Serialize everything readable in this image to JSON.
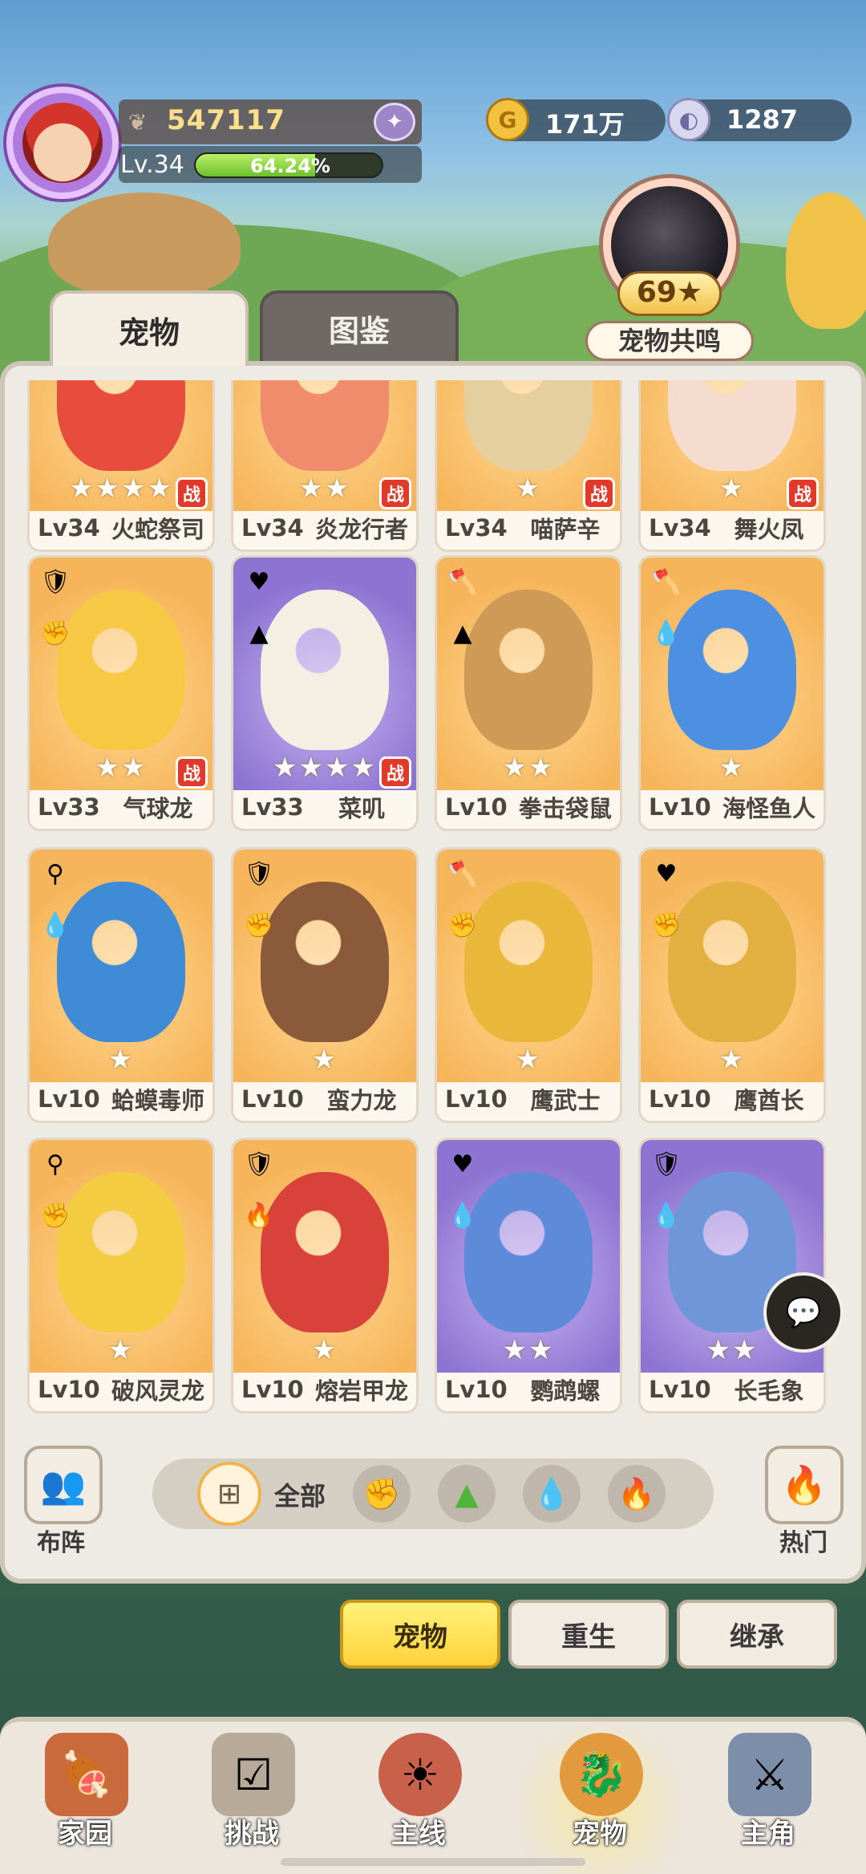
{
  "player": {
    "power": "547117",
    "level": "Lv.34",
    "exp_percent": 0.6424,
    "exp_text": "64.24%"
  },
  "currency": {
    "gold": "171万",
    "shell": "1287"
  },
  "resonance": {
    "count": "69★",
    "label": "宠物共鸣"
  },
  "tabs": {
    "pets": "宠物",
    "codex": "图鉴"
  },
  "pets": [
    {
      "level": "Lv34",
      "name": "火蛇祭司",
      "stars": "★★★★",
      "battle": "战",
      "bg": "orange",
      "attrs": [],
      "color": "#e74c3c"
    },
    {
      "level": "Lv34",
      "name": "炎龙行者",
      "stars": "★★",
      "battle": "战",
      "bg": "orange",
      "attrs": [],
      "color": "#f08b6c"
    },
    {
      "level": "Lv34",
      "name": "喵萨辛",
      "stars": "★",
      "battle": "战",
      "bg": "orange",
      "attrs": [],
      "color": "#e6cf9e"
    },
    {
      "level": "Lv34",
      "name": "舞火凤",
      "stars": "★",
      "battle": "战",
      "bg": "orange",
      "attrs": [],
      "color": "#f6dccf"
    },
    {
      "level": "Lv33",
      "name": "气球龙",
      "stars": "★★",
      "battle": "战",
      "bg": "orange",
      "attrs": [
        "shield",
        "fist"
      ],
      "color": "#f7c844"
    },
    {
      "level": "Lv33",
      "name": "菜叽",
      "stars": "★★★★",
      "battle": "战",
      "bg": "purple",
      "attrs": [
        "heart",
        "leaf"
      ],
      "color": "#f4efe3"
    },
    {
      "level": "Lv10",
      "name": "拳击袋鼠",
      "stars": "★★",
      "battle": "",
      "bg": "orange",
      "attrs": [
        "axe",
        "leaf"
      ],
      "color": "#cf9a55"
    },
    {
      "level": "Lv10",
      "name": "海怪鱼人",
      "stars": "★",
      "battle": "",
      "bg": "orange",
      "attrs": [
        "axe",
        "water"
      ],
      "color": "#4d8fe0"
    },
    {
      "level": "Lv10",
      "name": "蛤蟆毒师",
      "stars": "★",
      "battle": "",
      "bg": "orange",
      "attrs": [
        "wand",
        "water"
      ],
      "color": "#3f8bd6"
    },
    {
      "level": "Lv10",
      "name": "蛮力龙",
      "stars": "★",
      "battle": "",
      "bg": "orange",
      "attrs": [
        "shield",
        "fist"
      ],
      "color": "#8a5a3a"
    },
    {
      "level": "Lv10",
      "name": "鹰武士",
      "stars": "★",
      "battle": "",
      "bg": "orange",
      "attrs": [
        "axe",
        "fist"
      ],
      "color": "#e9b83a"
    },
    {
      "level": "Lv10",
      "name": "鹰酋长",
      "stars": "★",
      "battle": "",
      "bg": "orange",
      "attrs": [
        "heart",
        "fist"
      ],
      "color": "#e2b040"
    },
    {
      "level": "Lv10",
      "name": "破风灵龙",
      "stars": "★",
      "battle": "",
      "bg": "orange",
      "attrs": [
        "wand",
        "fist"
      ],
      "color": "#f3cc42"
    },
    {
      "level": "Lv10",
      "name": "熔岩甲龙",
      "stars": "★",
      "battle": "",
      "bg": "orange",
      "attrs": [
        "shield",
        "fire"
      ],
      "color": "#d9423a"
    },
    {
      "level": "Lv10",
      "name": "鹦鹉螺",
      "stars": "★★",
      "battle": "",
      "bg": "purple",
      "attrs": [
        "heart",
        "water"
      ],
      "color": "#5e8bd9"
    },
    {
      "level": "Lv10",
      "name": "长毛象",
      "stars": "★★",
      "battle": "",
      "bg": "purple",
      "attrs": [
        "shield",
        "water"
      ],
      "color": "#6e96d8"
    }
  ],
  "attr_icons": {
    "shield": "🛡",
    "fist": "✊",
    "heart": "♥",
    "leaf": "▲",
    "axe": "🪓",
    "water": "💧",
    "wand": "⚲",
    "fire": "🔥"
  },
  "bottom_bar": {
    "formation": "布阵",
    "hot": "热门",
    "all": "全部"
  },
  "actions": {
    "pets": "宠物",
    "rebirth": "重生",
    "inherit": "继承"
  },
  "nav": {
    "home": "家园",
    "challenge": "挑战",
    "main": "主线",
    "pets": "宠物",
    "hero": "主角"
  }
}
